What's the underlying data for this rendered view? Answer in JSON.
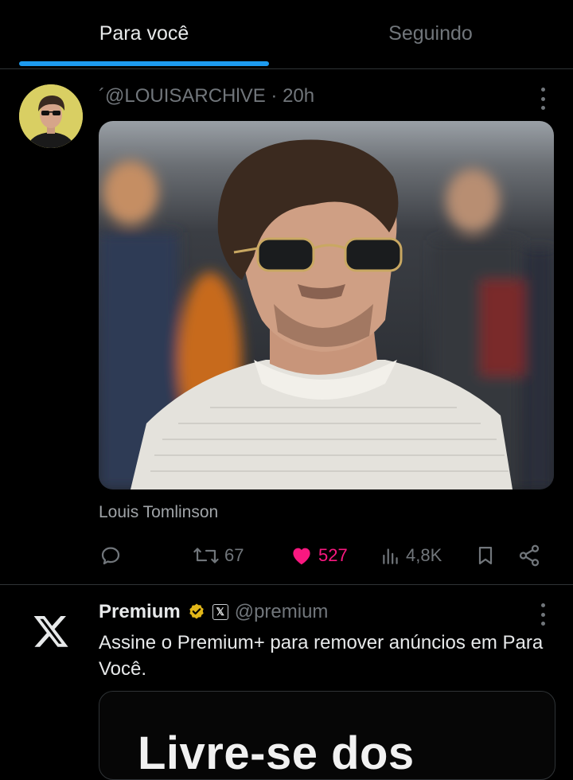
{
  "tabs": [
    {
      "label": "Para você",
      "active": true
    },
    {
      "label": "Seguindo",
      "active": false
    }
  ],
  "colors": {
    "accent": "#1d9bf0",
    "like": "#f91880",
    "muted": "#71767b",
    "verified": "#e2b719"
  },
  "post1": {
    "handle": "´@LOUISARCHlVE",
    "separator": "·",
    "time": "20h",
    "avatar_icon": "user-avatar-sunglasses",
    "caption": "Louis Tomlinson",
    "actions": {
      "reply_icon": "reply-icon",
      "retweets": "67",
      "likes": "527",
      "liked": true,
      "views": "4,8K",
      "bookmark_icon": "bookmark-icon",
      "share_icon": "share-icon"
    }
  },
  "post2": {
    "name": "Premium",
    "badge_icon": "verified-badge-icon",
    "affiliate_icon": "x-affiliate-icon",
    "affiliate_glyph": "𝕏",
    "handle": "@premium",
    "text": "Assine o Premium+ para remover anúncios em Para Você.",
    "card_text": "Livre-se dos"
  }
}
